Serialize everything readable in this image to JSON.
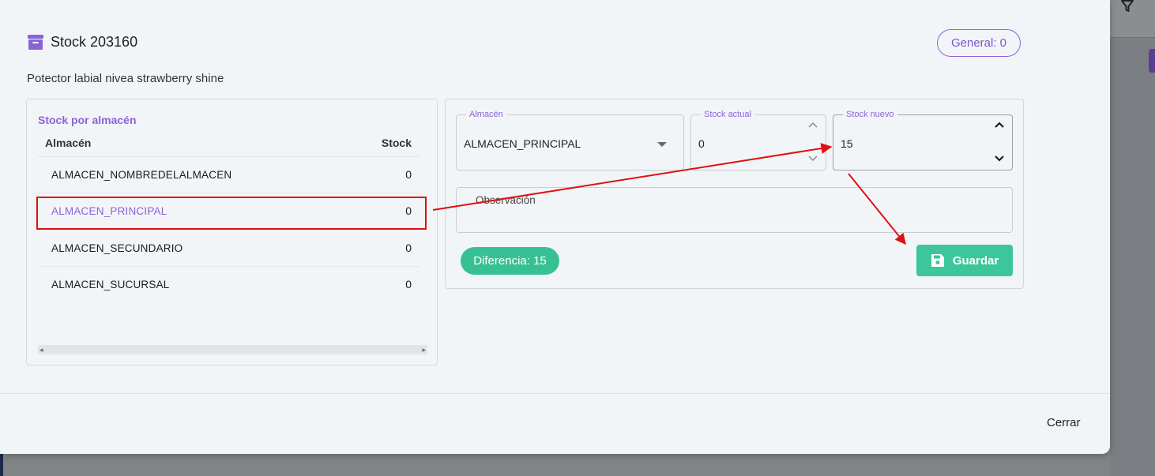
{
  "modal": {
    "title": "Stock 203160",
    "icon": "archive-icon",
    "general_badge": "General: 0",
    "product_name": "Potector labial nivea strawberry shine",
    "close_label": "Cerrar"
  },
  "stock_table": {
    "title": "Stock por almacén",
    "headers": {
      "warehouse": "Almacén",
      "stock": "Stock"
    },
    "rows": [
      {
        "warehouse": "ALMACEN_NOMBREDELALMACEN",
        "stock": "0"
      },
      {
        "warehouse": "ALMACEN_PRINCIPAL",
        "stock": "0"
      },
      {
        "warehouse": "ALMACEN_SECUNDARIO",
        "stock": "0"
      },
      {
        "warehouse": "ALMACEN_SUCURSAL",
        "stock": "0"
      }
    ],
    "selected_index": 1
  },
  "form": {
    "warehouse": {
      "label": "Almacén",
      "value": "ALMACEN_PRINCIPAL"
    },
    "current_stock": {
      "label": "Stock actual",
      "value": "0"
    },
    "new_stock": {
      "label": "Stock nuevo",
      "value": "15"
    },
    "observation": {
      "placeholder": "Observación"
    },
    "difference": "Diferencia: 15",
    "save_label": "Guardar"
  },
  "colors": {
    "accent": "#8b63d6",
    "success": "#3cc69a",
    "annotation": "#e01010"
  }
}
